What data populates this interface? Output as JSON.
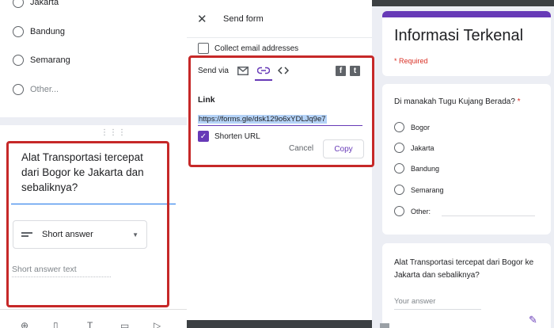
{
  "left_panel": {
    "options": [
      "Jakarta",
      "Bandung",
      "Semarang",
      "Other..."
    ],
    "question_title": "Alat Transportasi tercepat dari Bogor ke Jakarta dan sebaliknya?",
    "type_select_label": "Short answer",
    "short_answer_placeholder": "Short answer text"
  },
  "dialog": {
    "title": "Send form",
    "collect_email_label": "Collect email addresses",
    "send_via_label": "Send via",
    "link_label": "Link",
    "link_url": "https://forms.gle/dsk129o6xYDLJq9e7",
    "shorten_label": "Shorten URL",
    "shorten_checked": true,
    "cancel_label": "Cancel",
    "copy_label": "Copy",
    "icons": [
      "close-icon",
      "email-icon",
      "link-icon",
      "embed-icon",
      "facebook-icon",
      "twitter-icon"
    ]
  },
  "preview": {
    "form_title": "Informasi Terkenal",
    "required_note": "* Required",
    "q1": {
      "title": "Di manakah Tugu Kujang Berada?",
      "required_mark": "*",
      "options": [
        "Bogor",
        "Jakarta",
        "Bandung",
        "Semarang",
        "Other:"
      ]
    },
    "q2": {
      "title": "Alat Transportasi tercepat dari Bogor ke Jakarta dan sebaliknya?",
      "answer_placeholder": "Your answer"
    }
  },
  "colors": {
    "accent": "#673ab7",
    "highlight_border": "#c62828",
    "required": "#d93025",
    "background": "#eceef4"
  }
}
